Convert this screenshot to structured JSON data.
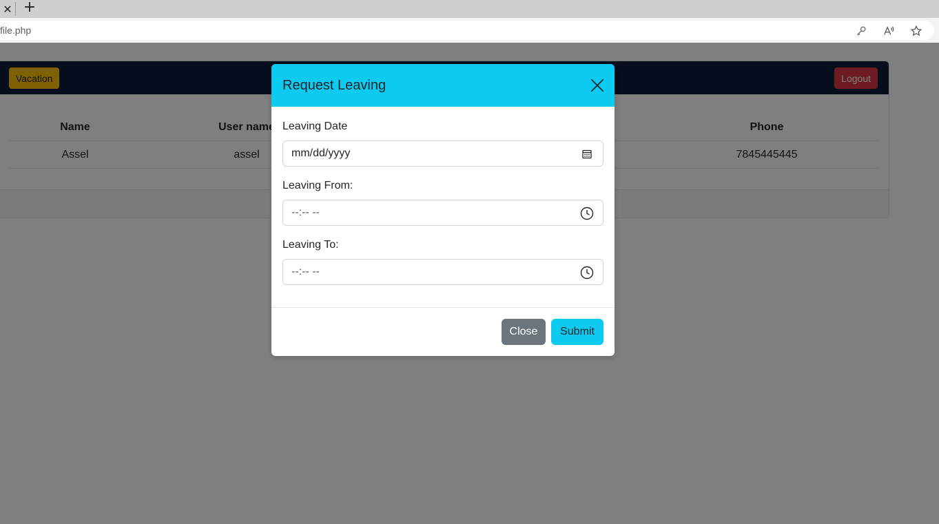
{
  "browser": {
    "url": "file.php",
    "tab_close_glyph": "✕",
    "new_tab_glyph": "+",
    "icons": [
      "key-icon",
      "read-aloud-icon",
      "favorite-star-icon"
    ]
  },
  "navbar": {
    "vacation_label": "Vacation",
    "logout_label": "Logout"
  },
  "table": {
    "columns": [
      "Name",
      "User name",
      "Phone"
    ],
    "rows": [
      {
        "name": "Assel",
        "username": "assel",
        "phone": "7845445445"
      }
    ]
  },
  "modal": {
    "title": "Request Leaving",
    "fields": {
      "date_label": "Leaving Date",
      "date_placeholder": "mm/dd/yyyy",
      "from_label": "Leaving From:",
      "from_placeholder": "--:-- --",
      "to_label": "Leaving To:",
      "to_placeholder": "--:-- --"
    },
    "close_label": "Close",
    "submit_label": "Submit"
  },
  "colors": {
    "modal_header": "#0dcaf0",
    "navbar_bg": "#0c1a3a",
    "vacation_btn": "#ffc107",
    "logout_btn": "#dc3545",
    "close_btn": "#6c757d",
    "submit_btn": "#0dcaf0"
  }
}
